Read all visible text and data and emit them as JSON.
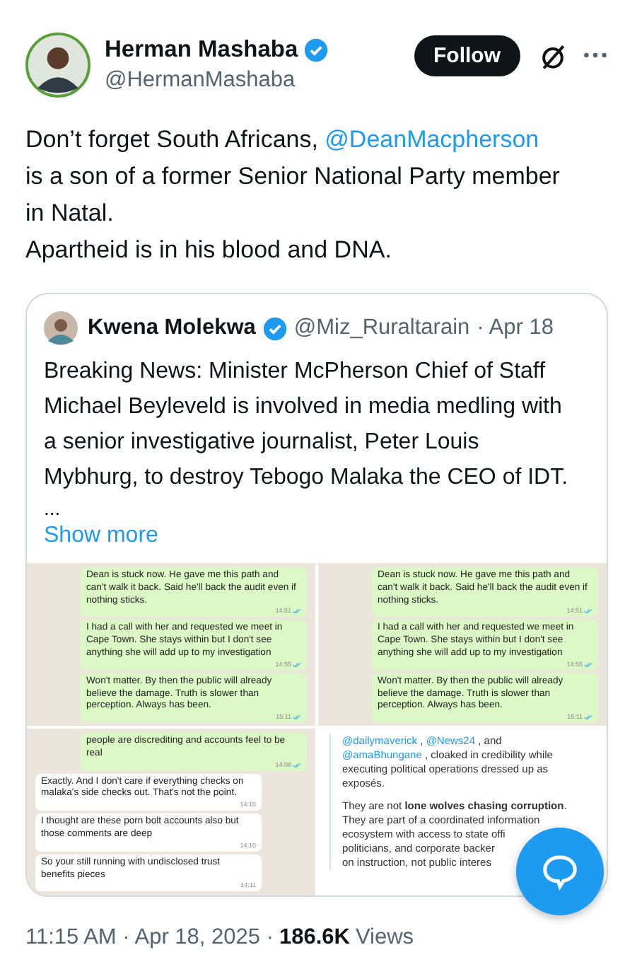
{
  "author": {
    "name": "Herman Mashaba",
    "handle": "@HermanMashaba",
    "verified": true
  },
  "follow_button": "Follow",
  "text_lines": [
    [
      {
        "kind": "text",
        "text": "Don’t forget South Africans, "
      },
      {
        "kind": "mention",
        "text": "@DeanMacpherson"
      }
    ],
    [
      {
        "kind": "text",
        "text": "is a son of a former Senior National Party member in Natal."
      }
    ],
    [
      {
        "kind": "text",
        "text": "Apartheid is in his blood and DNA."
      }
    ]
  ],
  "quote": {
    "author": {
      "name": "Kwena Molekwa",
      "verified": true,
      "handle": "@Miz_Ruraltarain",
      "date": "· Apr 18"
    },
    "text": "Breaking News: Minister McPherson Chief of Staff Michael Beyleveld is involved in media medling with a senior investigative journalist, Peter Louis Mybhurg, to destroy Tebogo Malaka the CEO of IDT.",
    "ellipsis": "...",
    "show_more": "Show more",
    "media": [
      {
        "kind": "chat",
        "messages": [
          {
            "kind": "outgoing",
            "text": "Dean is stuck now. He gave me this path and can't walk it back. Said he'll back the audit even if nothing sticks.",
            "time": "14:51"
          },
          {
            "kind": "outgoing",
            "text": "I had a call with her and requested we meet in Cape Town. She stays within but I don't see anything she will add up to my investigation",
            "time": "14:55"
          },
          {
            "kind": "outgoing",
            "text": "Won't matter. By then the public will already believe the damage. Truth is slower than perception. Always has been.",
            "time": "15:11"
          }
        ]
      },
      {
        "kind": "chat",
        "messages": [
          {
            "kind": "outgoing",
            "text": "Dean is stuck now. He gave me this path and can't walk it back. Said he'll back the audit even if nothing sticks.",
            "time": "14:51"
          },
          {
            "kind": "outgoing",
            "text": "I had a call with her and requested we meet in Cape Town. She stays within but I don't see anything she will add up to my investigation",
            "time": "14:55"
          },
          {
            "kind": "outgoing",
            "text": "Won't matter. By then the public will already believe the damage. Truth is slower than perception. Always has been.",
            "time": "15:11"
          }
        ]
      },
      {
        "kind": "chat",
        "messages": [
          {
            "kind": "outgoing",
            "text": "people are discrediting and accounts feel to be real",
            "time": "14:08"
          },
          {
            "kind": "incoming",
            "text": "Exactly. And I don't care if everything checks on malaka's side checks out. That's not the point.",
            "time": "14:10"
          },
          {
            "kind": "incoming",
            "text": "I thought are these porn bolt accounts also but those comments are deep",
            "time": "14:10"
          },
          {
            "kind": "incoming",
            "text": "So your still running  with undisclosed trust benefits pieces",
            "time": "14:11"
          }
        ]
      },
      {
        "kind": "document",
        "paragraphs": [
          [
            [
              {
                "kind": "mention",
                "text": "@dailymaverick"
              },
              {
                "kind": "text",
                "text": " , "
              },
              {
                "kind": "mention",
                "text": "@News24"
              },
              {
                "kind": "text",
                "text": " , and"
              }
            ],
            [
              {
                "kind": "mention",
                "text": "@amaBhungane"
              },
              {
                "kind": "text",
                "text": " , cloaked in credibility while"
              }
            ],
            [
              {
                "kind": "text",
                "text": "executing political operations dressed up as"
              }
            ],
            [
              {
                "kind": "text",
                "text": "exposés."
              }
            ]
          ],
          [
            [
              {
                "kind": "text",
                "text": "They are not **lone wolves chasing corruption**."
              }
            ],
            [
              {
                "kind": "text",
                "text": "They are part of a coordinated information"
              }
            ],
            [
              {
                "kind": "text",
                "text": "ecosystem with access to state offi"
              }
            ],
            [
              {
                "kind": "text",
                "text": "politicians, and corporate backer"
              }
            ],
            [
              {
                "kind": "text",
                "text": "on instruction, not public interes"
              }
            ]
          ]
        ]
      }
    ]
  },
  "footer": {
    "time": "11:15 AM · Apr 18, 2025 ·",
    "views_count": "186.6K",
    "views_label": "Views"
  }
}
